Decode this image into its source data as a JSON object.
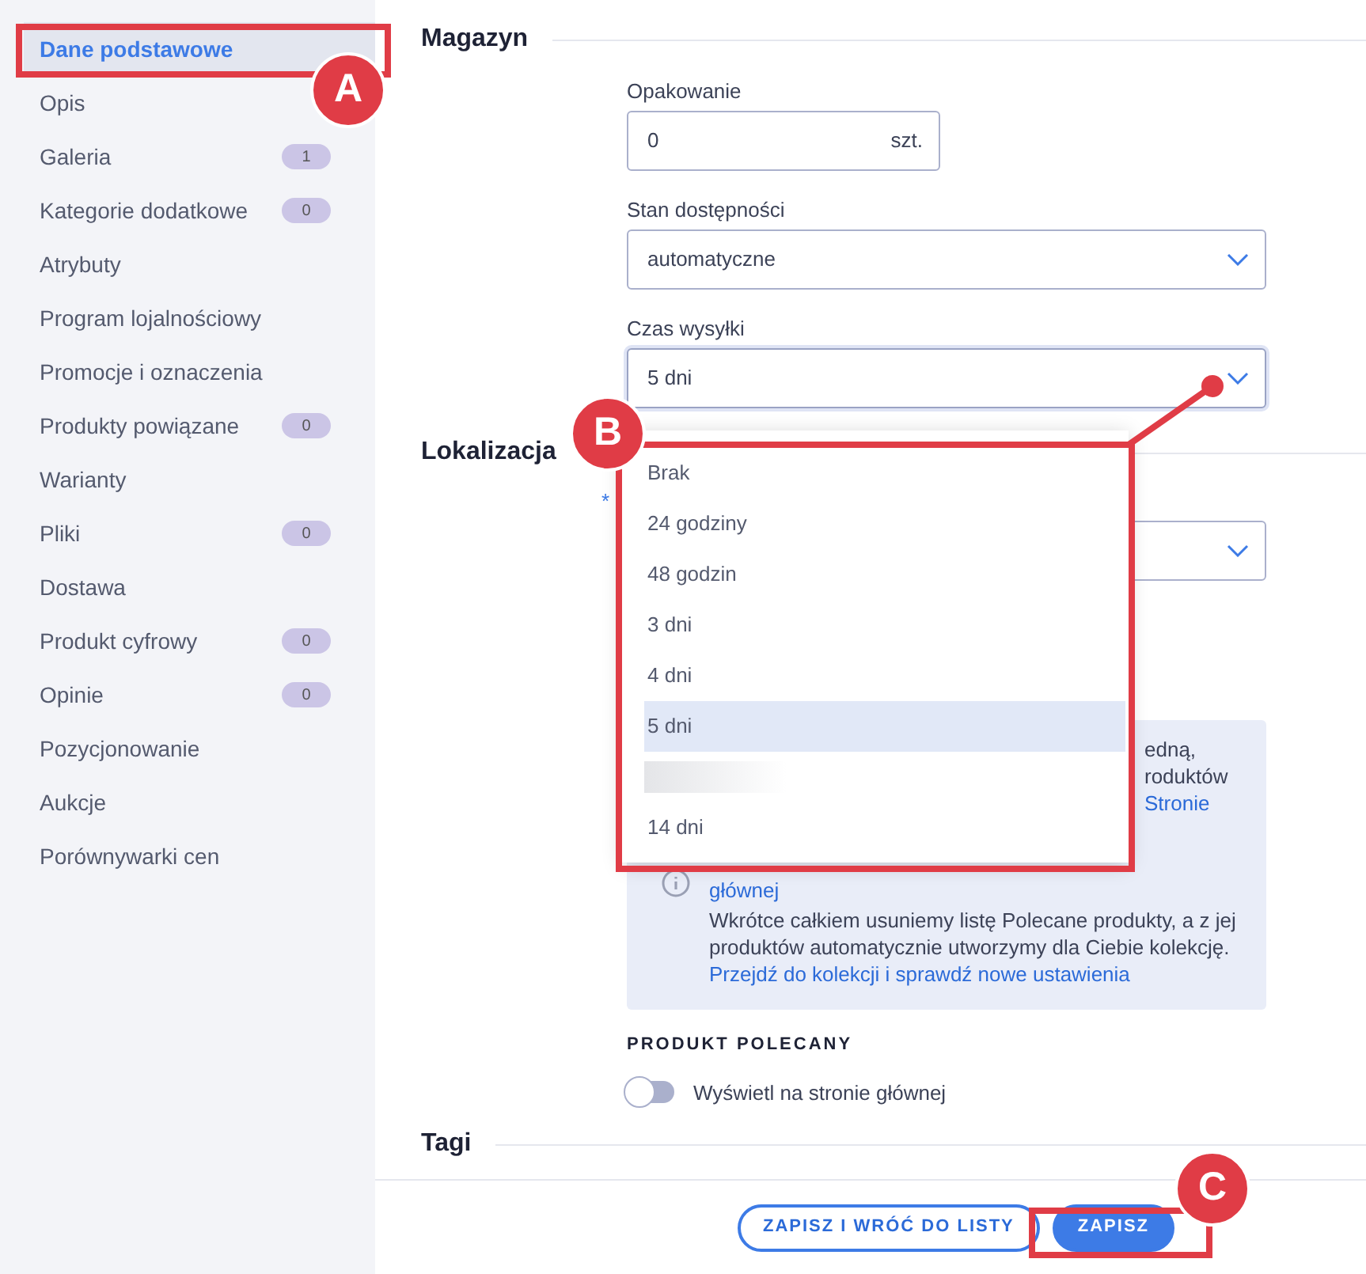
{
  "sidebar": {
    "items": [
      {
        "label": "Dane podstawowe",
        "selected": true
      },
      {
        "label": "Opis",
        "selected": false
      },
      {
        "label": "Galeria",
        "count": "1",
        "selected": false
      },
      {
        "label": "Kategorie dodatkowe",
        "count": "0",
        "selected": false
      },
      {
        "label": "Atrybuty",
        "selected": false
      },
      {
        "label": "Program lojalnościowy",
        "selected": false
      },
      {
        "label": "Promocje i oznaczenia",
        "selected": false
      },
      {
        "label": "Produkty powiązane",
        "count": "0",
        "selected": false
      },
      {
        "label": "Warianty",
        "selected": false
      },
      {
        "label": "Pliki",
        "count": "0",
        "selected": false
      },
      {
        "label": "Dostawa",
        "selected": false
      },
      {
        "label": "Produkt cyfrowy",
        "count": "0",
        "selected": false
      },
      {
        "label": "Opinie",
        "count": "0",
        "selected": false
      },
      {
        "label": "Pozycjonowanie",
        "selected": false
      },
      {
        "label": "Aukcje",
        "selected": false
      },
      {
        "label": "Porównywarki cen",
        "selected": false
      }
    ]
  },
  "magazyn": {
    "title": "Magazyn",
    "fields": [
      {
        "kind": "input",
        "label": "Opakowanie",
        "value": "0",
        "suffix": "szt."
      },
      {
        "kind": "select",
        "label": "Stan dostępności",
        "value": "automatyczne",
        "expanded": false
      },
      {
        "kind": "select",
        "label": "Czas wysyłki",
        "value": "5 dni",
        "expanded": true
      }
    ]
  },
  "dropdown": {
    "options": [
      {
        "kind": "option",
        "label": "Brak",
        "selected": false
      },
      {
        "kind": "option",
        "label": "24 godziny",
        "selected": false
      },
      {
        "kind": "option",
        "label": "48 godzin",
        "selected": false
      },
      {
        "kind": "option",
        "label": "3 dni",
        "selected": false
      },
      {
        "kind": "option",
        "label": "4 dni",
        "selected": false
      },
      {
        "kind": "option",
        "label": "5 dni",
        "selected": true
      },
      {
        "kind": "blurred",
        "selected": false
      },
      {
        "kind": "option",
        "label": "14 dni",
        "selected": false
      }
    ]
  },
  "lokalizacja": {
    "title": "Lokalizacja",
    "required_mark": "*",
    "notice": {
      "fragments": [
        {
          "text": "edną,",
          "link": false
        },
        {
          "text": "roduktów",
          "link": false
        },
        {
          "text": "Stronie",
          "link": true
        }
      ],
      "fragment_link": "głównej",
      "text": "Wkrótce całkiem usuniemy listę Polecane produkty, a z jej produktów automatycznie utworzymy dla Ciebie kolekcję.",
      "link": "Przejdź do kolekcji i sprawdź nowe ustawienia"
    },
    "featured": {
      "title": "PRODUKT POLECANY",
      "toggle_label": "Wyświetl na stronie głównej",
      "on": false
    }
  },
  "tagi": {
    "title": "Tagi"
  },
  "footer": {
    "buttons": [
      {
        "label": "ZAPISZ I WRÓĆ DO LISTY",
        "kind": "outline"
      },
      {
        "label": "ZAPISZ",
        "kind": "primary"
      }
    ]
  },
  "annotations": [
    {
      "label": "A"
    },
    {
      "label": "B"
    },
    {
      "label": "C"
    }
  ]
}
